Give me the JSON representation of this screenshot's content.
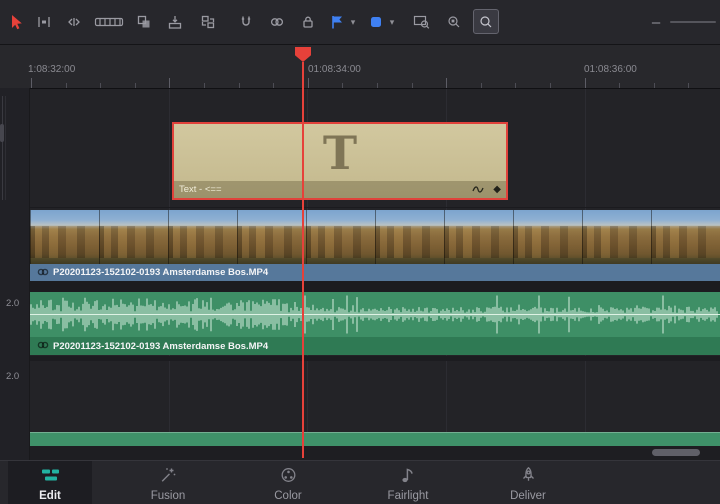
{
  "colors": {
    "playhead_red": "#e6413a",
    "selection_red": "#e0423b",
    "flag_blue": "#3f80f2",
    "edit_teal": "#22b2a1",
    "title_clip_tan": "#c9bf97",
    "video_bar_blue": "#56789b",
    "audio_green": "#3e8f66",
    "audio_bar_green": "#2f7a54"
  },
  "toolbar": {
    "tools": [
      "selection-tool",
      "trim-edit-mode",
      "dynamic-trim-mode",
      "blade-edit-mode",
      "insert-clip-button",
      "overwrite-clip-button",
      "replace-clip-button",
      "snapping-toggle",
      "linked-selection-toggle",
      "position-lock-toggle",
      "add-flag-button",
      "flag-dropdown",
      "add-marker-button",
      "marker-dropdown",
      "zoom-full-extent-button",
      "zoom-detail-button",
      "zoom-custom-button",
      "zoom-out-button",
      "zoom-slider"
    ],
    "minus_glyph": "–",
    "chevron_glyph": "▾"
  },
  "ruler": {
    "timecodes": [
      "1:08:32:00",
      "01:08:34:00",
      "01:08:36:00"
    ]
  },
  "timeline": {
    "title_clip": {
      "name": "Text - <==",
      "glyph": "T",
      "diamond_glyph": "◆",
      "badges": [
        "curve-icon",
        "keyframe-diamond-icon"
      ]
    },
    "video_clip": {
      "name": "P20201123-152102-0193 Amsterdamse Bos.MP4"
    },
    "audio_clip": {
      "name": "P20201123-152102-0193 Amsterdamse Bos.MP4",
      "channel_format": "2.0"
    },
    "audio_track2": {
      "channel_format": "2.0"
    }
  },
  "nav": {
    "active": "Edit",
    "items": [
      "Edit",
      "Fusion",
      "Color",
      "Fairlight",
      "Deliver"
    ]
  }
}
